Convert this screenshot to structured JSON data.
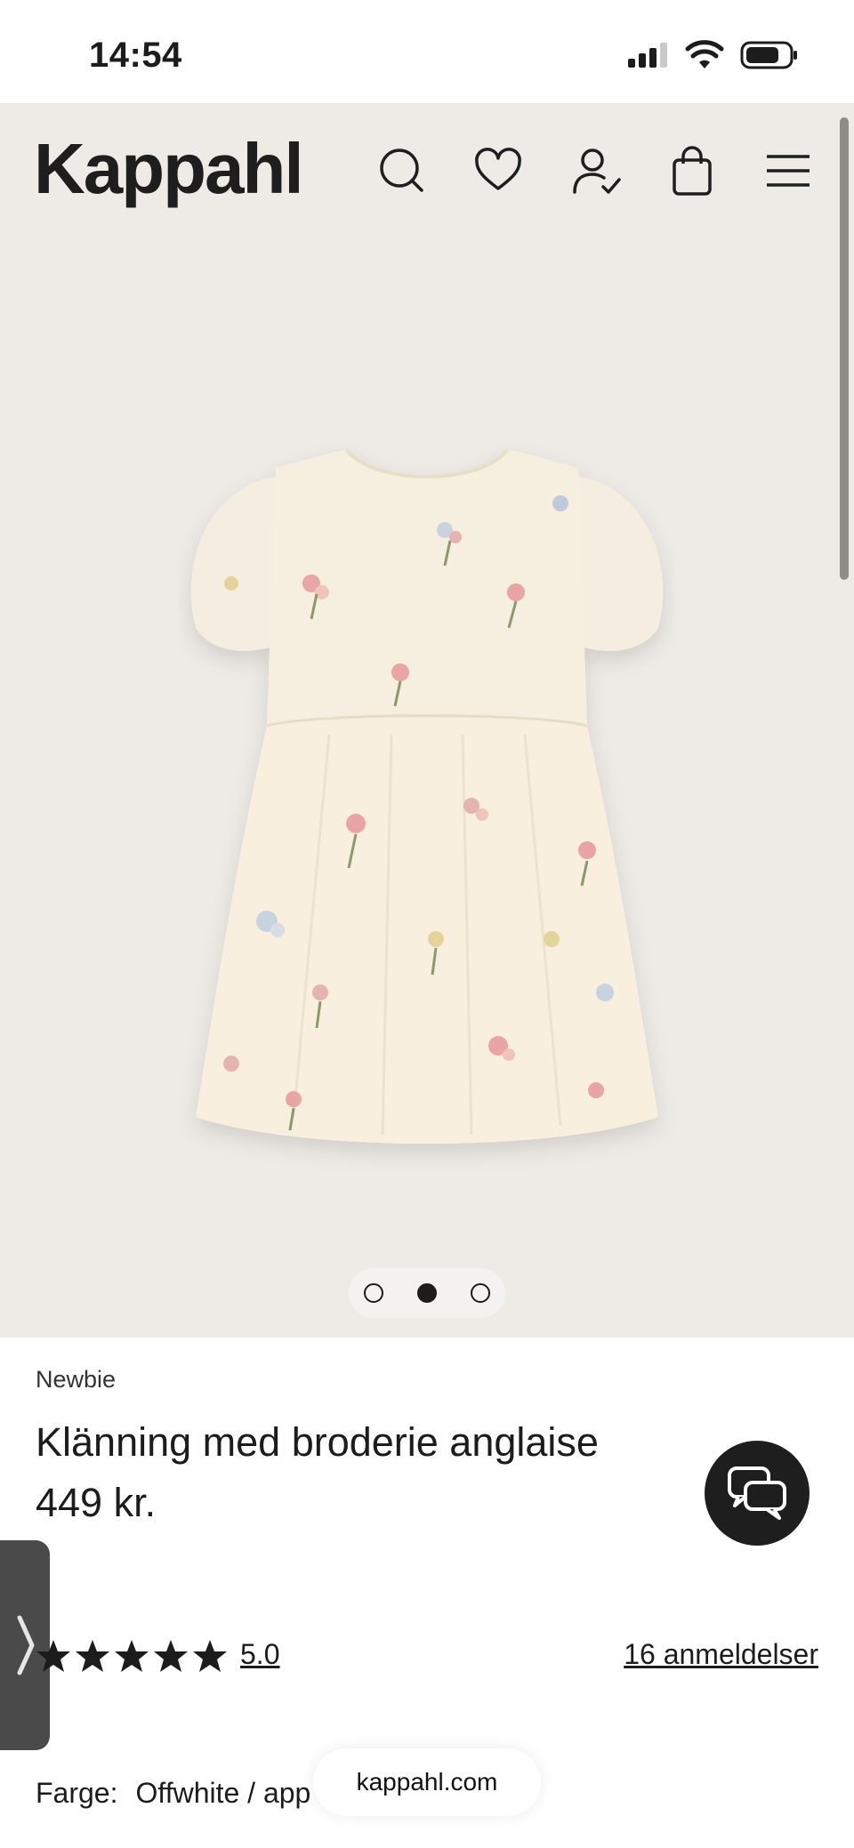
{
  "status": {
    "time": "14:54"
  },
  "header": {
    "logo": "Kappahl"
  },
  "gallery": {
    "image_count": 3,
    "active_index": 1
  },
  "product": {
    "brand": "Newbie",
    "title": "Klänning med broderie anglaise",
    "price": "449 kr.",
    "rating_value": "5.0",
    "rating_stars": 5,
    "reviews_label": "16 anmeldelser",
    "color_label": "Farge:",
    "color_value": "Offwhite / app"
  },
  "browser": {
    "url": "kappahl.com"
  },
  "colors": {
    "hero_bg": "#eeebe6",
    "ink": "#1c1c1c",
    "dress": "#f6efe0"
  },
  "icons": [
    "search-icon",
    "heart-icon",
    "account-icon",
    "bag-icon",
    "menu-icon",
    "chat-icon",
    "chevron-right-icon",
    "star-icon"
  ]
}
